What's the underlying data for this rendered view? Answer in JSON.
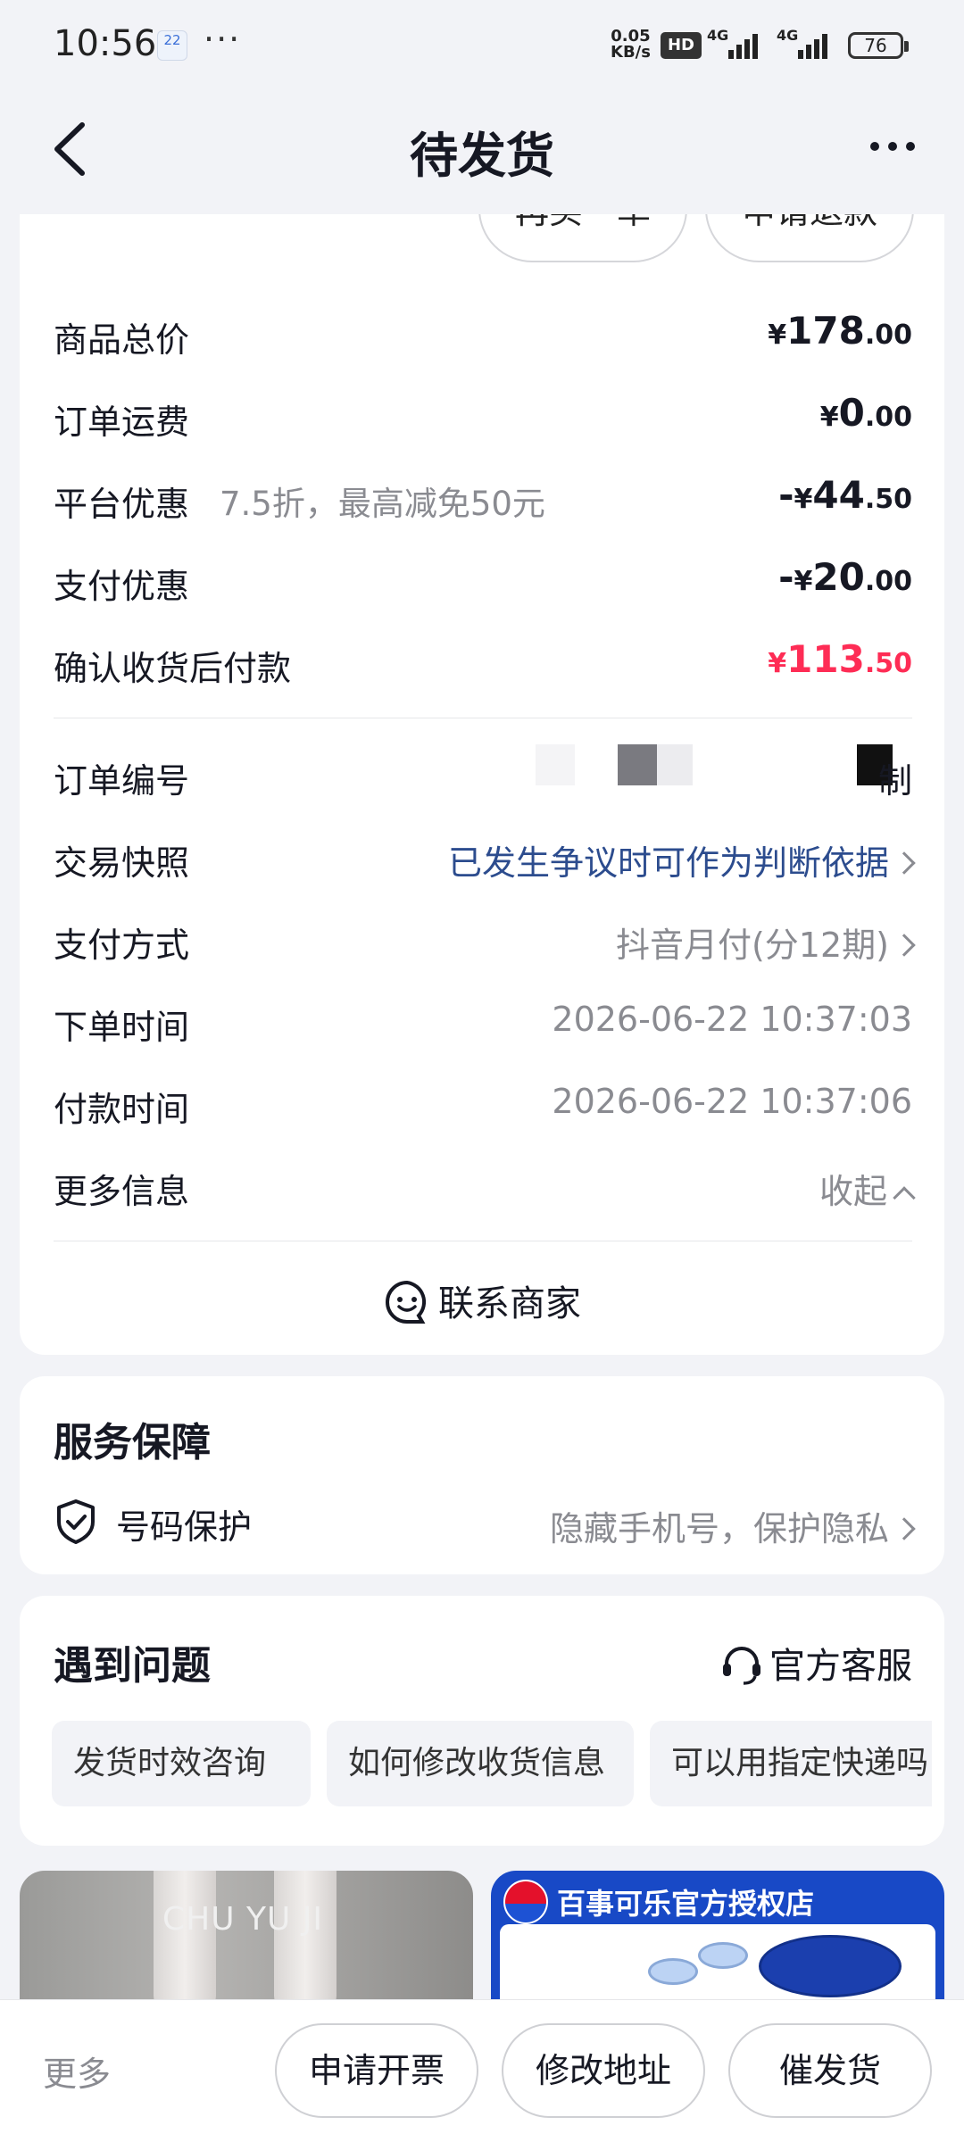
{
  "status_bar": {
    "time": "10:56",
    "calendar_day": "22",
    "dots": "···",
    "net_speed_value": "0.05",
    "net_speed_unit": "KB/s",
    "hd": "HD",
    "signal1": "4G",
    "signal2": "4G",
    "battery": "76"
  },
  "nav": {
    "title": "待发货"
  },
  "top_buttons": {
    "buy_again": "再买一单",
    "refund": "申请退款"
  },
  "price_rows": [
    {
      "label": "商品总价",
      "sign": "",
      "currency": "¥",
      "int": "178",
      "dec": ".00"
    },
    {
      "label": "订单运费",
      "sign": "",
      "currency": "¥",
      "int": "0",
      "dec": ".00"
    },
    {
      "label": "平台优惠",
      "note": "7.5折，最高减免50元",
      "sign": "-",
      "currency": "¥",
      "int": "44",
      "dec": ".50"
    },
    {
      "label": "支付优惠",
      "sign": "-",
      "currency": "¥",
      "int": "20",
      "dec": ".00"
    },
    {
      "label": "确认收货后付款",
      "sign": "",
      "currency": "¥",
      "int": "113",
      "dec": ".50"
    }
  ],
  "info_rows": {
    "order_no": {
      "label": "订单编号",
      "suffix": "制"
    },
    "snapshot": {
      "label": "交易快照",
      "value": "已发生争议时可作为判断依据"
    },
    "payment": {
      "label": "支付方式",
      "value": "抖音月付(分12期)"
    },
    "order_time": {
      "label": "下单时间",
      "value": "2026-06-22 10:37:03"
    },
    "pay_time": {
      "label": "付款时间",
      "value": "2026-06-22 10:37:06"
    },
    "more_info": {
      "label": "更多信息",
      "value": "收起"
    }
  },
  "contact_merchant": "联系商家",
  "service": {
    "title": "服务保障",
    "item_label": "号码保护",
    "item_value": "隐藏手机号，保护隐私"
  },
  "problems": {
    "title": "遇到问题",
    "official_service": "官方客服",
    "chips": [
      "发货时效咨询",
      "如何修改收货信息",
      "可以用指定快递吗"
    ]
  },
  "products": {
    "left_brand": "CHU YU JI",
    "right_shop": "百事可乐官方授权店"
  },
  "bottom_bar": {
    "more": "更多",
    "invoice": "申请开票",
    "edit_address": "修改地址",
    "urge": "催发货"
  }
}
